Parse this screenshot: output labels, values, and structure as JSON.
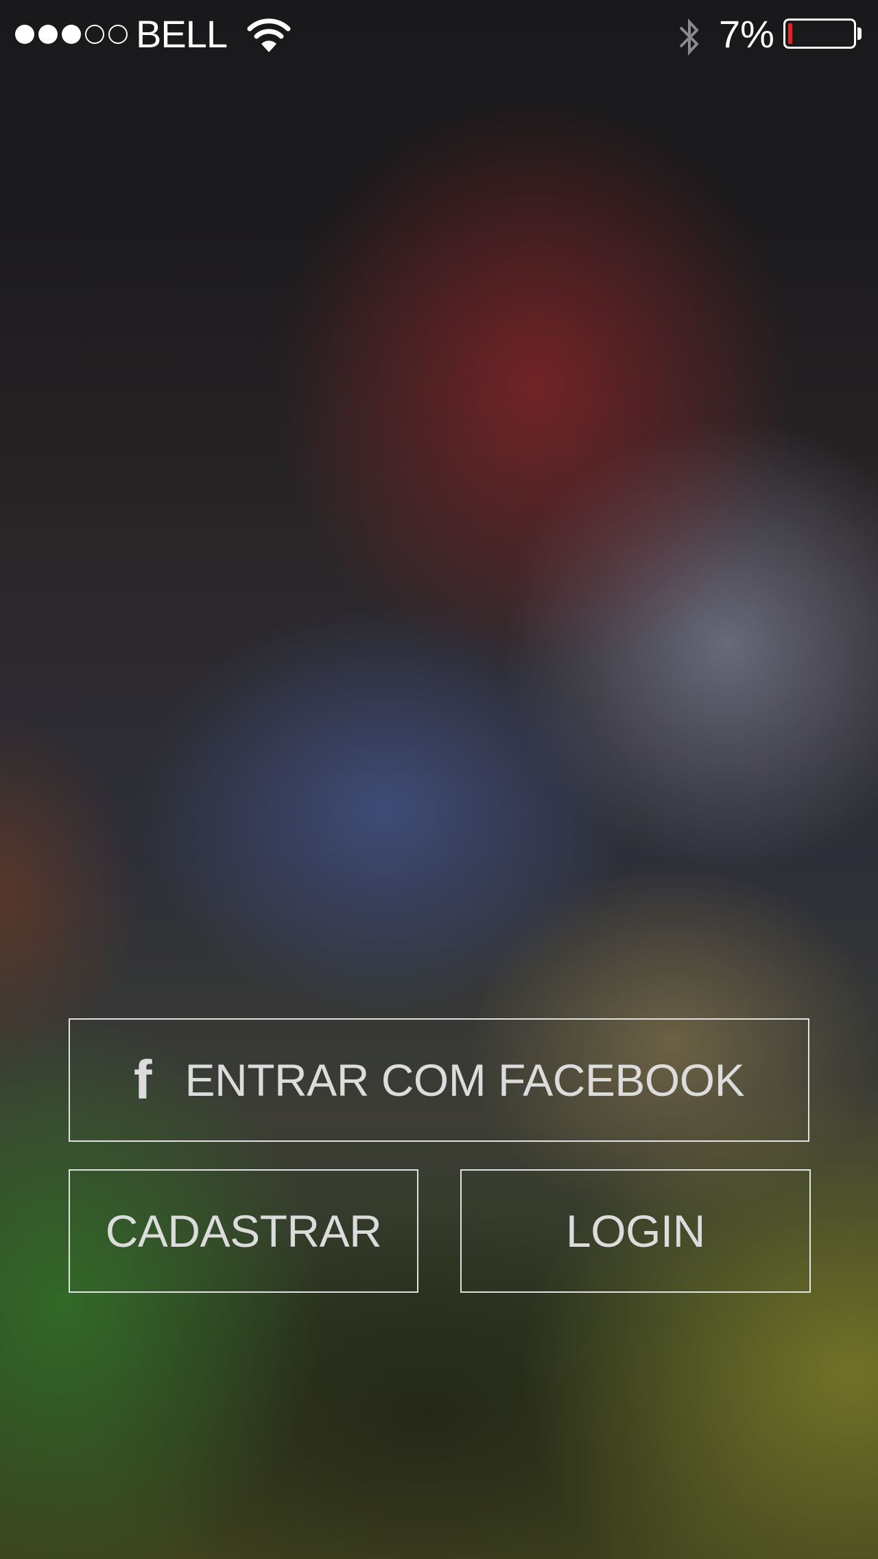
{
  "status_bar": {
    "signal_bars_filled": 3,
    "signal_bars_total": 5,
    "carrier": "BELL",
    "wifi_icon": "wifi-icon",
    "bluetooth_icon": "bluetooth-icon",
    "battery_percent_label": "7%",
    "battery_level": 0.07,
    "battery_fill_color": "#e5221f"
  },
  "actions": {
    "facebook_icon": "facebook-icon",
    "facebook_label": "ENTRAR COM FACEBOOK",
    "register_label": "CADASTRAR",
    "login_label": "LOGIN"
  }
}
